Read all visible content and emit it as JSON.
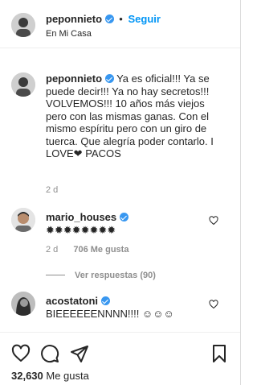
{
  "header": {
    "username": "peponnieto",
    "separator": "•",
    "follow_label": "Seguir",
    "location": "En Mi Casa"
  },
  "caption": {
    "username": "peponnieto",
    "text": "Ya es oficial!!! Ya se puede decir!!! Ya no hay secretos!!! VOLVEMOS!!! 10 años más viejos pero con las mismas ganas. Con el mismo espíritu pero con un giro de tuerca. Que alegría poder contarlo. I LOVE❤ PACOS",
    "time": "2 d"
  },
  "comments": [
    {
      "username": "mario_houses",
      "text": "✹✹✹✹✹✹✹✹",
      "time": "2 d",
      "likes": "706 Me gusta",
      "view_replies": "Ver respuestas (90)"
    },
    {
      "username": "acostatoni",
      "text": "BIEEEEEENNNN!!!! ☺☺☺"
    }
  ],
  "footer": {
    "likes_count": "32,630",
    "likes_label": "Me gusta"
  },
  "icons": {
    "like": "heart-outline-icon",
    "comment": "speech-bubble-icon",
    "share": "paper-plane-icon",
    "save": "bookmark-icon"
  },
  "colors": {
    "link": "#0095f6",
    "verified": "#3897f0",
    "muted": "#8e8e8e",
    "text": "#262626"
  }
}
